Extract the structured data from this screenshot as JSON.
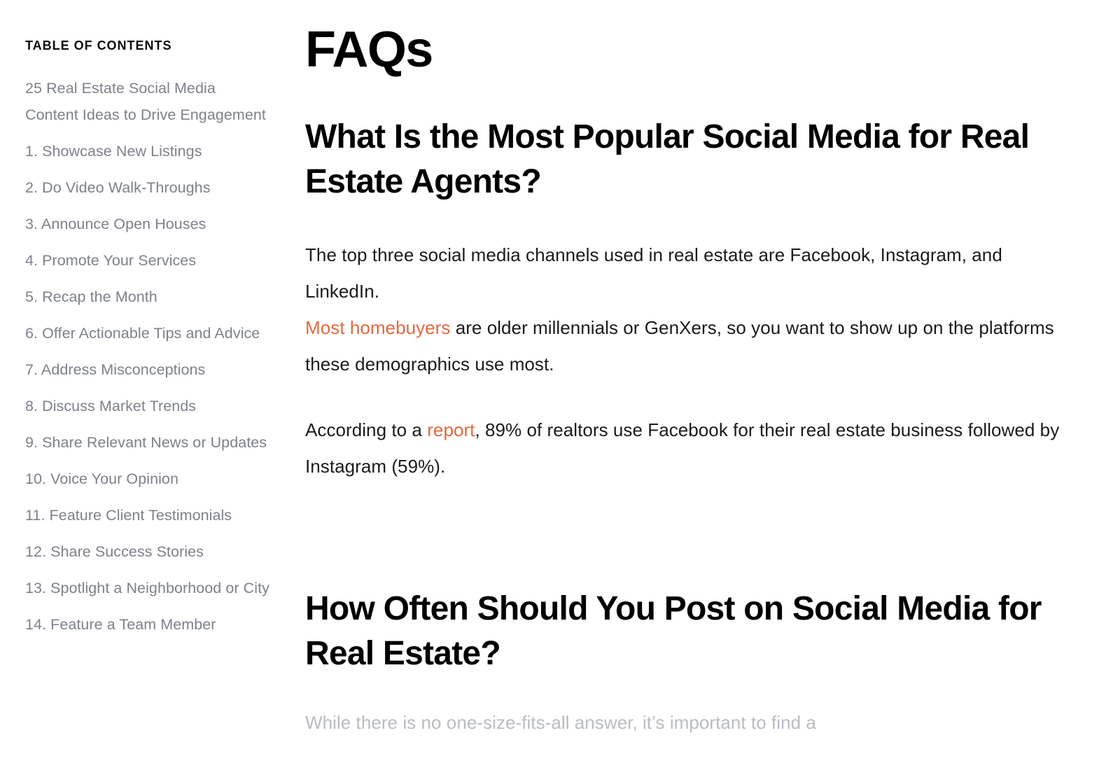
{
  "colors": {
    "accent": "#e4683c",
    "body_text": "#1b1b1b",
    "muted_text": "#7d818a",
    "faded_text": "#b9bcc1",
    "background": "#ffffff"
  },
  "sidebar": {
    "heading": "TABLE OF CONTENTS",
    "items": [
      {
        "label": "25 Real Estate Social Media Content Ideas to Drive Engagement"
      },
      {
        "label": "1. Showcase New Listings"
      },
      {
        "label": "2. Do Video Walk-Throughs"
      },
      {
        "label": "3. Announce Open Houses"
      },
      {
        "label": "4. Promote Your Services"
      },
      {
        "label": "5. Recap the Month"
      },
      {
        "label": "6. Offer Actionable Tips and Advice"
      },
      {
        "label": "7. Address Misconceptions"
      },
      {
        "label": "8. Discuss Market Trends"
      },
      {
        "label": "9. Share Relevant News or Updates"
      },
      {
        "label": "10. Voice Your Opinion"
      },
      {
        "label": "11. Feature Client Testimonials"
      },
      {
        "label": "12. Share Success Stories"
      },
      {
        "label": "13. Spotlight a Neighborhood or City"
      },
      {
        "label": "14. Feature a Team Member"
      }
    ]
  },
  "main": {
    "title": "FAQs",
    "section_one": {
      "heading": "What Is the Most Popular Social Media for Real Estate Agents?",
      "paragraph_one": {
        "line_one": "The top three social media channels used in real estate are Facebook, Instagram, and LinkedIn.",
        "link_text": "Most homebuyers",
        "after_link": " are older millennials or GenXers, so you want to show up on the platforms these demographics use most."
      },
      "paragraph_two": {
        "before_link": "According to a ",
        "link_text": "report",
        "after_link": ", 89% of realtors use Facebook for their real estate business followed by Instagram (59%)."
      }
    },
    "section_two": {
      "heading": "How Often Should You Post on Social Media for Real Estate?",
      "paragraph_one": "While there is no one-size-fits-all answer, it’s important to find a"
    }
  }
}
